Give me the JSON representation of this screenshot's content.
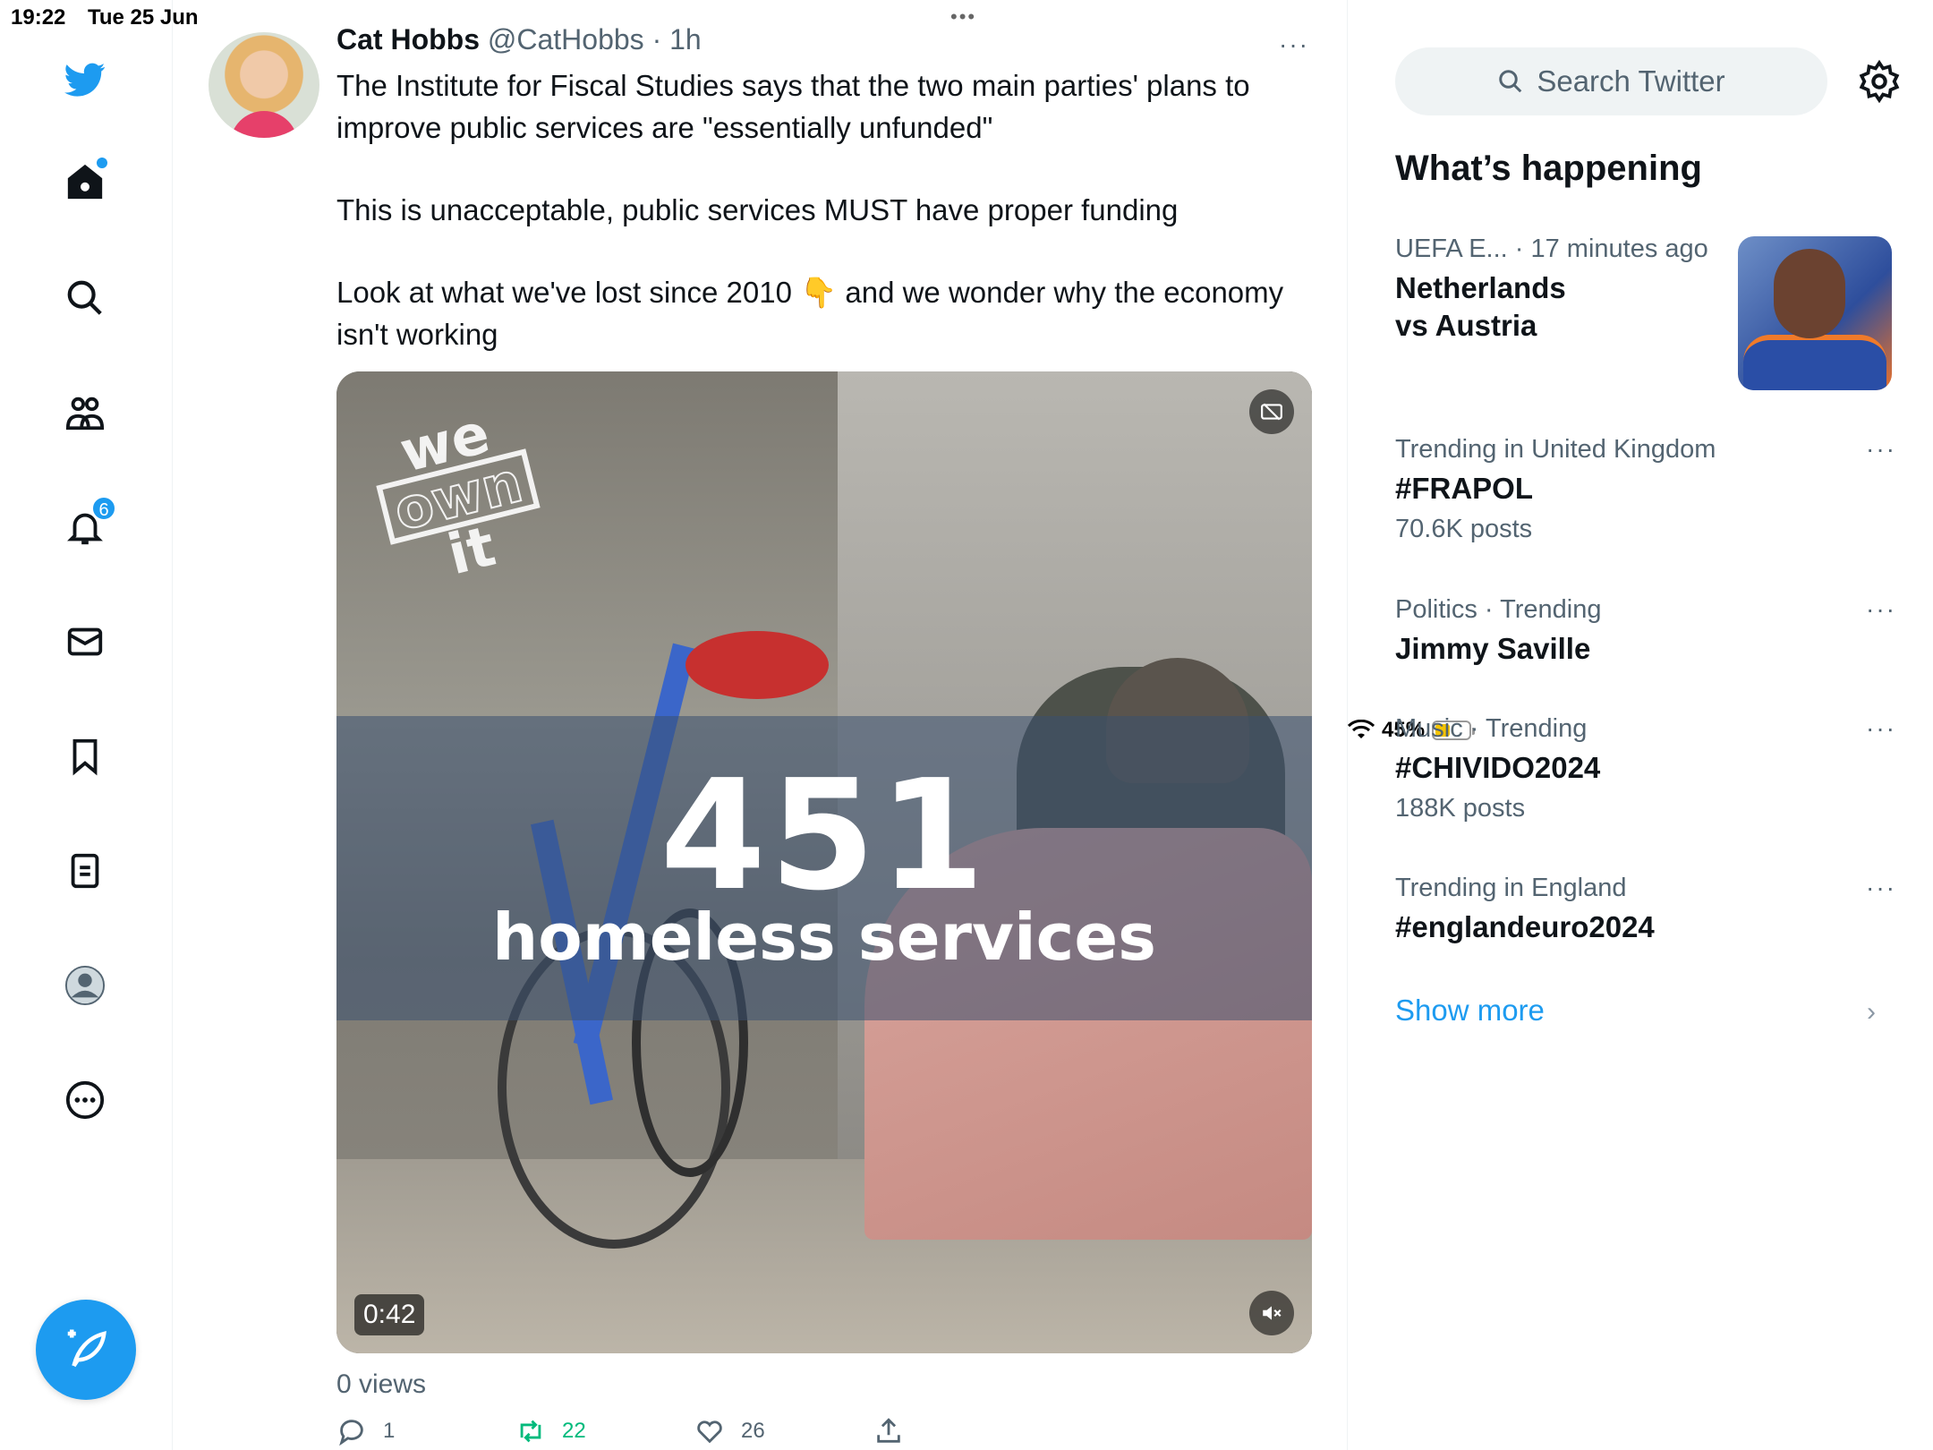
{
  "status_bar": {
    "time": "19:22",
    "date": "Tue 25 Jun",
    "battery": "45%",
    "battery_fraction": 0.45,
    "multitask_dots": "•••"
  },
  "nav": {
    "items": [
      {
        "name": "twitter-logo",
        "icon": "bird"
      },
      {
        "name": "home",
        "icon": "home-icon",
        "has_dot": true
      },
      {
        "name": "explore",
        "icon": "search-icon"
      },
      {
        "name": "communities",
        "icon": "people-icon"
      },
      {
        "name": "notifications",
        "icon": "bell-icon",
        "badge": "6"
      },
      {
        "name": "messages",
        "icon": "mail-icon"
      },
      {
        "name": "bookmarks",
        "icon": "bookmark-icon"
      },
      {
        "name": "lists",
        "icon": "list-icon"
      },
      {
        "name": "profile",
        "icon": "avatar-icon"
      },
      {
        "name": "more",
        "icon": "more-circle-icon"
      }
    ],
    "accent": "#1d9bf0"
  },
  "tweet": {
    "author_name": "Cat Hobbs",
    "author_handle": "@CatHobbs · 1h",
    "more": "···",
    "paragraphs": [
      "The Institute for Fiscal Studies says that the two main parties' plans to improve public services are \"essentially unfunded\"",
      "This is unacceptable, public services MUST have proper funding",
      "Look at what we've lost since 2010 👇 and we wonder why the economy isn't working"
    ],
    "media": {
      "watermark_line1": "we",
      "watermark_line2": "own",
      "watermark_line3": "it",
      "overlay_number": "451",
      "overlay_label": "homeless services",
      "duration": "0:42"
    },
    "views": "0 views",
    "replies": "1",
    "retweets": "22",
    "likes": "26",
    "retweet_color": "#00ba7c"
  },
  "sidebar": {
    "search_placeholder": "Search Twitter",
    "section_title": "What’s happening",
    "trends": [
      {
        "meta": "UEFA E... · 17 minutes ago",
        "title_line1": "Netherlands",
        "title_line2": "vs Austria",
        "posts": ""
      },
      {
        "meta": "Trending in United Kingdom",
        "title_line1": "#FRAPOL",
        "title_line2": "",
        "posts": "70.6K posts"
      },
      {
        "meta": "Politics · Trending",
        "title_line1": "Jimmy Saville",
        "title_line2": "",
        "posts": ""
      },
      {
        "meta": "Music · Trending",
        "title_line1": "#CHIVIDO2024",
        "title_line2": "",
        "posts": "188K posts"
      },
      {
        "meta": "Trending in England",
        "title_line1": "#englandeuro2024",
        "title_line2": "",
        "posts": ""
      }
    ],
    "more_dots": "···",
    "show_more": "Show more",
    "chevron": "›"
  }
}
